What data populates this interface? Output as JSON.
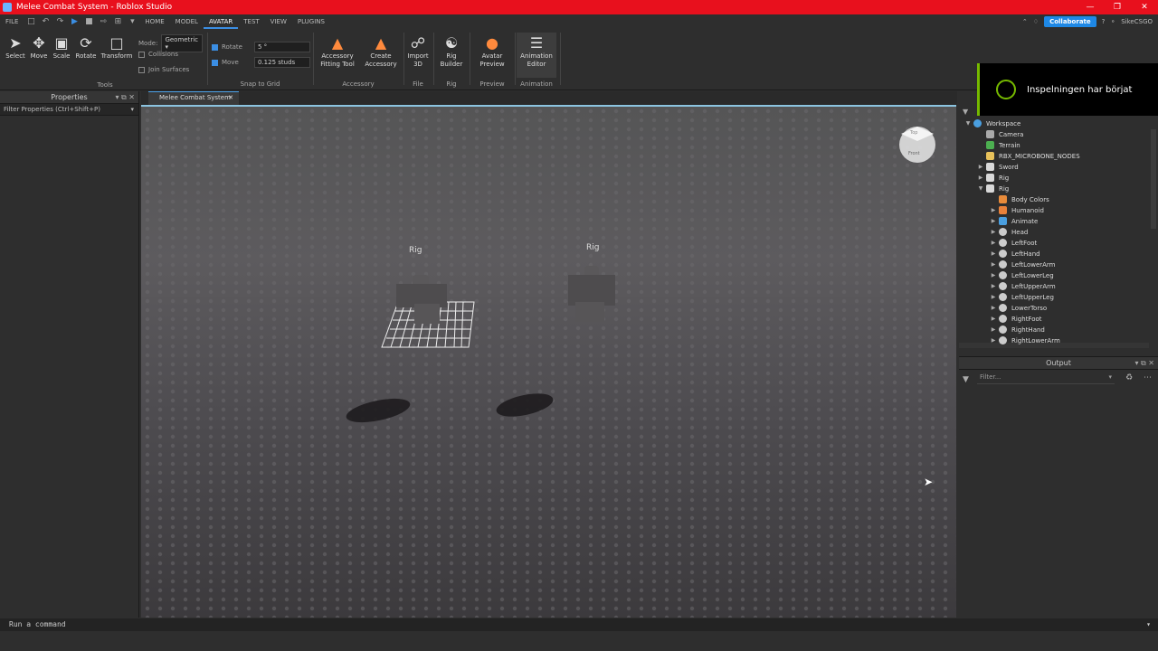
{
  "window": {
    "title": "Melee Combat System - Roblox Studio"
  },
  "menu": {
    "file": "FILE",
    "tabs": [
      "HOME",
      "MODEL",
      "AVATAR",
      "TEST",
      "VIEW",
      "PLUGINS"
    ],
    "active_tab": "AVATAR",
    "collaborate": "Collaborate",
    "user": "SikeCSGO"
  },
  "ribbon": {
    "tools": {
      "label": "Tools",
      "items": [
        "Select",
        "Move",
        "Scale",
        "Rotate",
        "Transform"
      ]
    },
    "mode": {
      "label": "Mode:",
      "value": "Geometric"
    },
    "collisions": "Collisions",
    "join_surfaces": "Join Surfaces",
    "snap": {
      "label": "Snap to Grid",
      "rotate_label": "Rotate",
      "rotate_value": "5 °",
      "move_label": "Move",
      "move_value": "0.125 studs"
    },
    "accessory": {
      "label": "Accessory",
      "fitting_line1": "Accessory",
      "fitting_line2": "Fitting Tool",
      "create_line1": "Create",
      "create_line2": "Accessory"
    },
    "file_group": {
      "label": "File",
      "line1": "Import",
      "line2": "3D"
    },
    "rig_group": {
      "label": "Rig",
      "line1": "Rig",
      "line2": "Builder"
    },
    "preview_group": {
      "label": "Preview",
      "line1": "Avatar",
      "line2": "Preview"
    },
    "animation_group": {
      "label": "Animation",
      "line1": "Animation",
      "line2": "Editor"
    }
  },
  "properties": {
    "title": "Properties",
    "filter": "Filter Properties (Ctrl+Shift+P)"
  },
  "editor": {
    "tab": "Melee Combat System"
  },
  "viewport": {
    "rig_labels": [
      "Rig",
      "Rig"
    ],
    "viewcube_top": "Top",
    "viewcube_front": "Front"
  },
  "explorer": {
    "nodes": [
      {
        "name": "Workspace",
        "depth": 0,
        "expanded": true,
        "icon": "workspace-icon",
        "color": "#4a9fe0"
      },
      {
        "name": "Camera",
        "depth": 1,
        "icon": "camera-icon",
        "color": "#aaaaaa"
      },
      {
        "name": "Terrain",
        "depth": 1,
        "icon": "terrain-icon",
        "color": "#4caf50"
      },
      {
        "name": "RBX_MICROBONE_NODES",
        "depth": 1,
        "icon": "folder-icon",
        "color": "#e8c15a"
      },
      {
        "name": "Sword",
        "depth": 1,
        "collapsed": true,
        "icon": "model-icon",
        "color": "#d9d9d9"
      },
      {
        "name": "Rig",
        "depth": 1,
        "collapsed": true,
        "icon": "model-icon",
        "color": "#d9d9d9"
      },
      {
        "name": "Rig",
        "depth": 1,
        "expanded": true,
        "icon": "model-icon",
        "color": "#d9d9d9"
      },
      {
        "name": "Body Colors",
        "depth": 2,
        "icon": "palette-icon",
        "color": "#e88b3a"
      },
      {
        "name": "Humanoid",
        "depth": 2,
        "collapsed": true,
        "icon": "humanoid-icon",
        "color": "#e8813a"
      },
      {
        "name": "Animate",
        "depth": 2,
        "collapsed": true,
        "icon": "script-icon",
        "color": "#4a9fe0"
      },
      {
        "name": "Head",
        "depth": 2,
        "collapsed": true,
        "icon": "meshpart-icon",
        "color": "#cccccc"
      },
      {
        "name": "LeftFoot",
        "depth": 2,
        "collapsed": true,
        "icon": "meshpart-icon",
        "color": "#cccccc"
      },
      {
        "name": "LeftHand",
        "depth": 2,
        "collapsed": true,
        "icon": "meshpart-icon",
        "color": "#cccccc"
      },
      {
        "name": "LeftLowerArm",
        "depth": 2,
        "collapsed": true,
        "icon": "meshpart-icon",
        "color": "#cccccc"
      },
      {
        "name": "LeftLowerLeg",
        "depth": 2,
        "collapsed": true,
        "icon": "meshpart-icon",
        "color": "#cccccc"
      },
      {
        "name": "LeftUpperArm",
        "depth": 2,
        "collapsed": true,
        "icon": "meshpart-icon",
        "color": "#cccccc"
      },
      {
        "name": "LeftUpperLeg",
        "depth": 2,
        "collapsed": true,
        "icon": "meshpart-icon",
        "color": "#cccccc"
      },
      {
        "name": "LowerTorso",
        "depth": 2,
        "collapsed": true,
        "icon": "meshpart-icon",
        "color": "#cccccc"
      },
      {
        "name": "RightFoot",
        "depth": 2,
        "collapsed": true,
        "icon": "meshpart-icon",
        "color": "#cccccc"
      },
      {
        "name": "RightHand",
        "depth": 2,
        "collapsed": true,
        "icon": "meshpart-icon",
        "color": "#cccccc"
      },
      {
        "name": "RightLowerArm",
        "depth": 2,
        "collapsed": true,
        "icon": "meshpart-icon",
        "color": "#cccccc"
      }
    ]
  },
  "output": {
    "title": "Output",
    "filter_placeholder": "Filter..."
  },
  "command_bar": {
    "placeholder": "Run a command"
  },
  "toast": {
    "text": "Inspelningen har börjat"
  },
  "colors": {
    "titlebar": "#e8101d",
    "accent": "#3b8ee3",
    "collaborate": "#1e88e5",
    "recording": "#76b900"
  }
}
